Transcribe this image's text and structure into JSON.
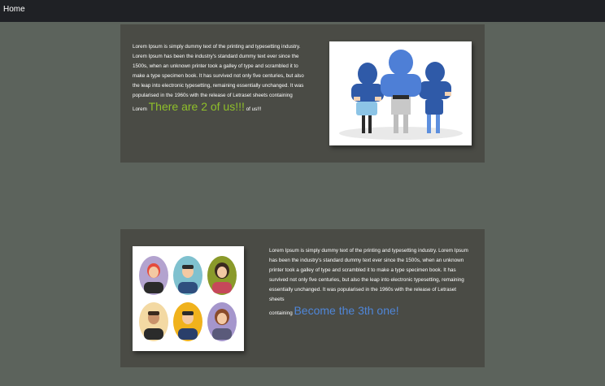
{
  "navbar": {
    "home_label": "Home"
  },
  "section1": {
    "paragraph": "Lorem Ipsum is simply dummy text of the printing and typesetting industry. Lorem Ipsum has been the industry's standard dummy text ever since the 1500s, when an unknown printer took a galley of type and scrambled it to make a type specimen book. It has survived not only five centuries, but also the leap into electronic typesetting, remaining essentially unchanged. It was popularised in the 1960s with the release of Letraset sheets containing",
    "prefix": "Lorem",
    "highlight": "There are 2 of us!!!",
    "suffix": "of us!!!",
    "highlight_color": "#8fbf2a"
  },
  "section2": {
    "paragraph": "Lorem Ipsum is simply dummy text of the printing and typesetting industry. Lorem Ipsum has been the industry's standard dummy text ever since the 1500s, when an unknown printer took a galley of type and scrambled it to make a type specimen book. It has survived not only five centuries, but also the leap into electronic typesetting, remaining essentially unchanged. It was popularised in the 1960s with the release of Letraset sheets",
    "prefix": "containing",
    "highlight": "Become the 3th one!",
    "highlight_color": "#4f86d8"
  },
  "colors": {
    "page_bg": "#5c635c",
    "navbar_bg": "#1f2125",
    "card_bg": "#4a4b45",
    "people_blue": "#2f5aa8",
    "people_center_blue": "#4e7fd6"
  },
  "images": {
    "team_illustration": "three-people-icon",
    "avatars_illustration": "avatar-grid-icon"
  }
}
